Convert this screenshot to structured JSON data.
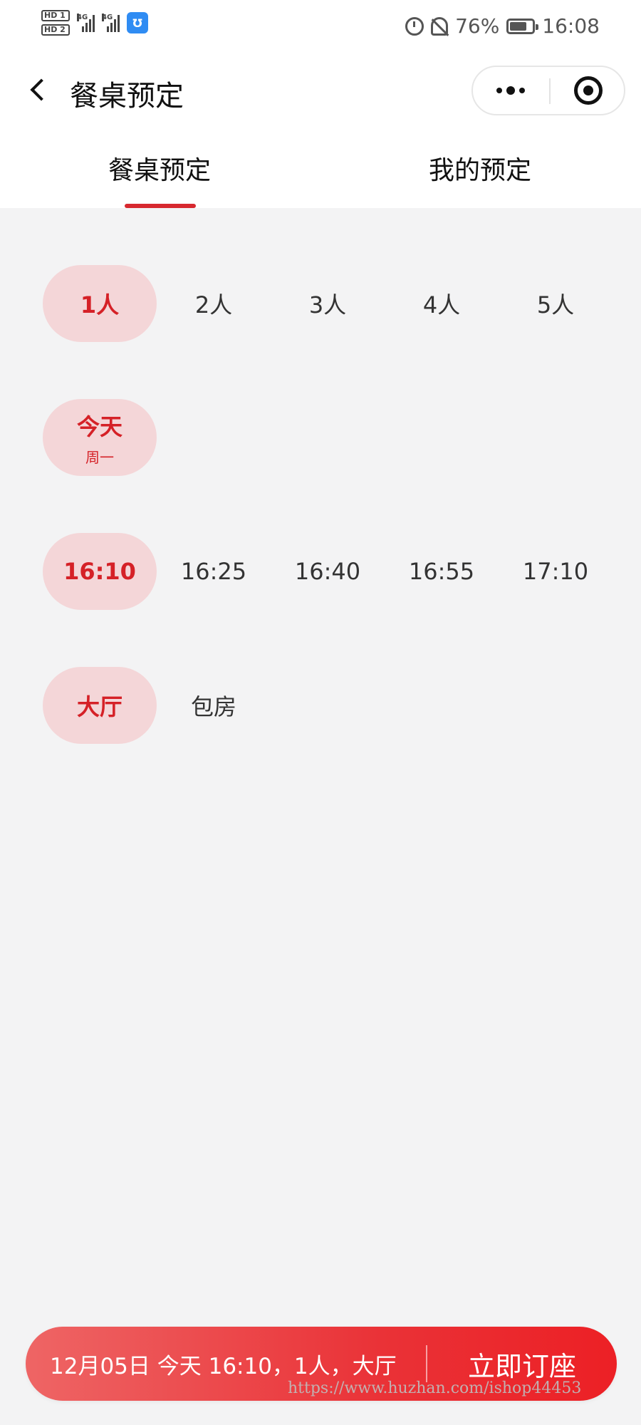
{
  "status_bar": {
    "hd1": "HD 1",
    "hd2": "HD 2",
    "net1": "4G",
    "net2": "4G",
    "battery_text": "76%",
    "battery_level": 0.76,
    "time": "16:08",
    "icons": [
      "alarm-icon",
      "mute-icon",
      "battery-icon",
      "app-notification-icon"
    ]
  },
  "header": {
    "title": "餐桌预定"
  },
  "tabs": [
    {
      "label": "餐桌预定",
      "active": true
    },
    {
      "label": "我的预定",
      "active": false
    }
  ],
  "people": {
    "options": [
      "1人",
      "2人",
      "3人",
      "4人",
      "5人"
    ],
    "selected_index": 0
  },
  "date": {
    "options": [
      {
        "label": "今天",
        "sub": "周一"
      }
    ],
    "selected_index": 0
  },
  "time": {
    "options": [
      "16:10",
      "16:25",
      "16:40",
      "16:55",
      "17:10"
    ],
    "selected_index": 0
  },
  "room": {
    "options": [
      "大厅",
      "包房"
    ],
    "selected_index": 0
  },
  "booking_bar": {
    "summary": "12月05日 今天 16:10，1人，大厅",
    "button_label": "立即订座"
  },
  "watermark": "https://www.huzhan.com/ishop44453",
  "colors": {
    "accent": "#d7282f",
    "selected_bg": "#f4d6d8",
    "bar_gradient_start": "#ee6565",
    "bar_gradient_end": "#ec2025",
    "page_bg": "#f3f3f4"
  }
}
